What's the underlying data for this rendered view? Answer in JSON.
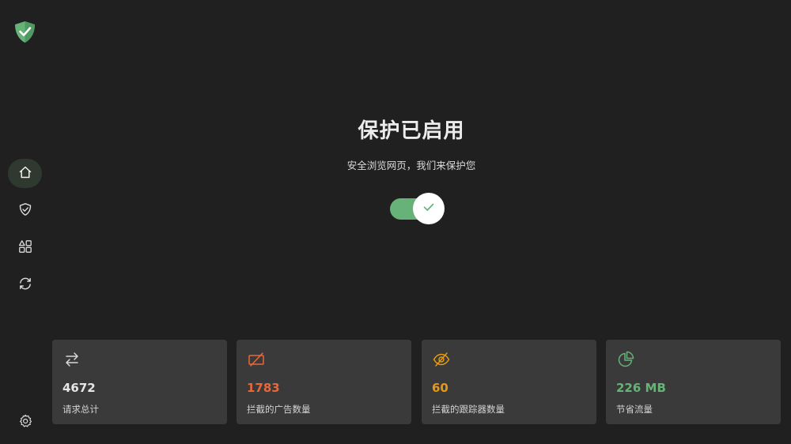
{
  "sidebar": {
    "logo_icon": "shield-check-logo",
    "items": [
      {
        "icon": "home-icon",
        "active": true
      },
      {
        "icon": "shield-check-icon",
        "active": false
      },
      {
        "icon": "apps-icon",
        "active": false
      },
      {
        "icon": "sync-icon",
        "active": false
      }
    ],
    "settings_icon": "gear-icon"
  },
  "hero": {
    "title": "保护已启用",
    "subtitle": "安全浏览网页，我们来保护您",
    "toggle_on": true
  },
  "stats": [
    {
      "icon": "swap-arrows-icon",
      "value": "4672",
      "label": "请求总计",
      "color": "#e6e6e6"
    },
    {
      "icon": "ad-blocked-icon",
      "value": "1783",
      "label": "拦截的广告数量",
      "color": "#e8683a"
    },
    {
      "icon": "eye-off-icon",
      "value": "60",
      "label": "拦截的跟踪器数量",
      "color": "#e59a12"
    },
    {
      "icon": "pie-chart-icon",
      "value": "226 MB",
      "label": "节省流量",
      "color": "#67b279"
    }
  ],
  "colors": {
    "background": "#202020",
    "card": "#3a3a3a",
    "accent": "#67b279",
    "active_nav": "#30392f"
  }
}
